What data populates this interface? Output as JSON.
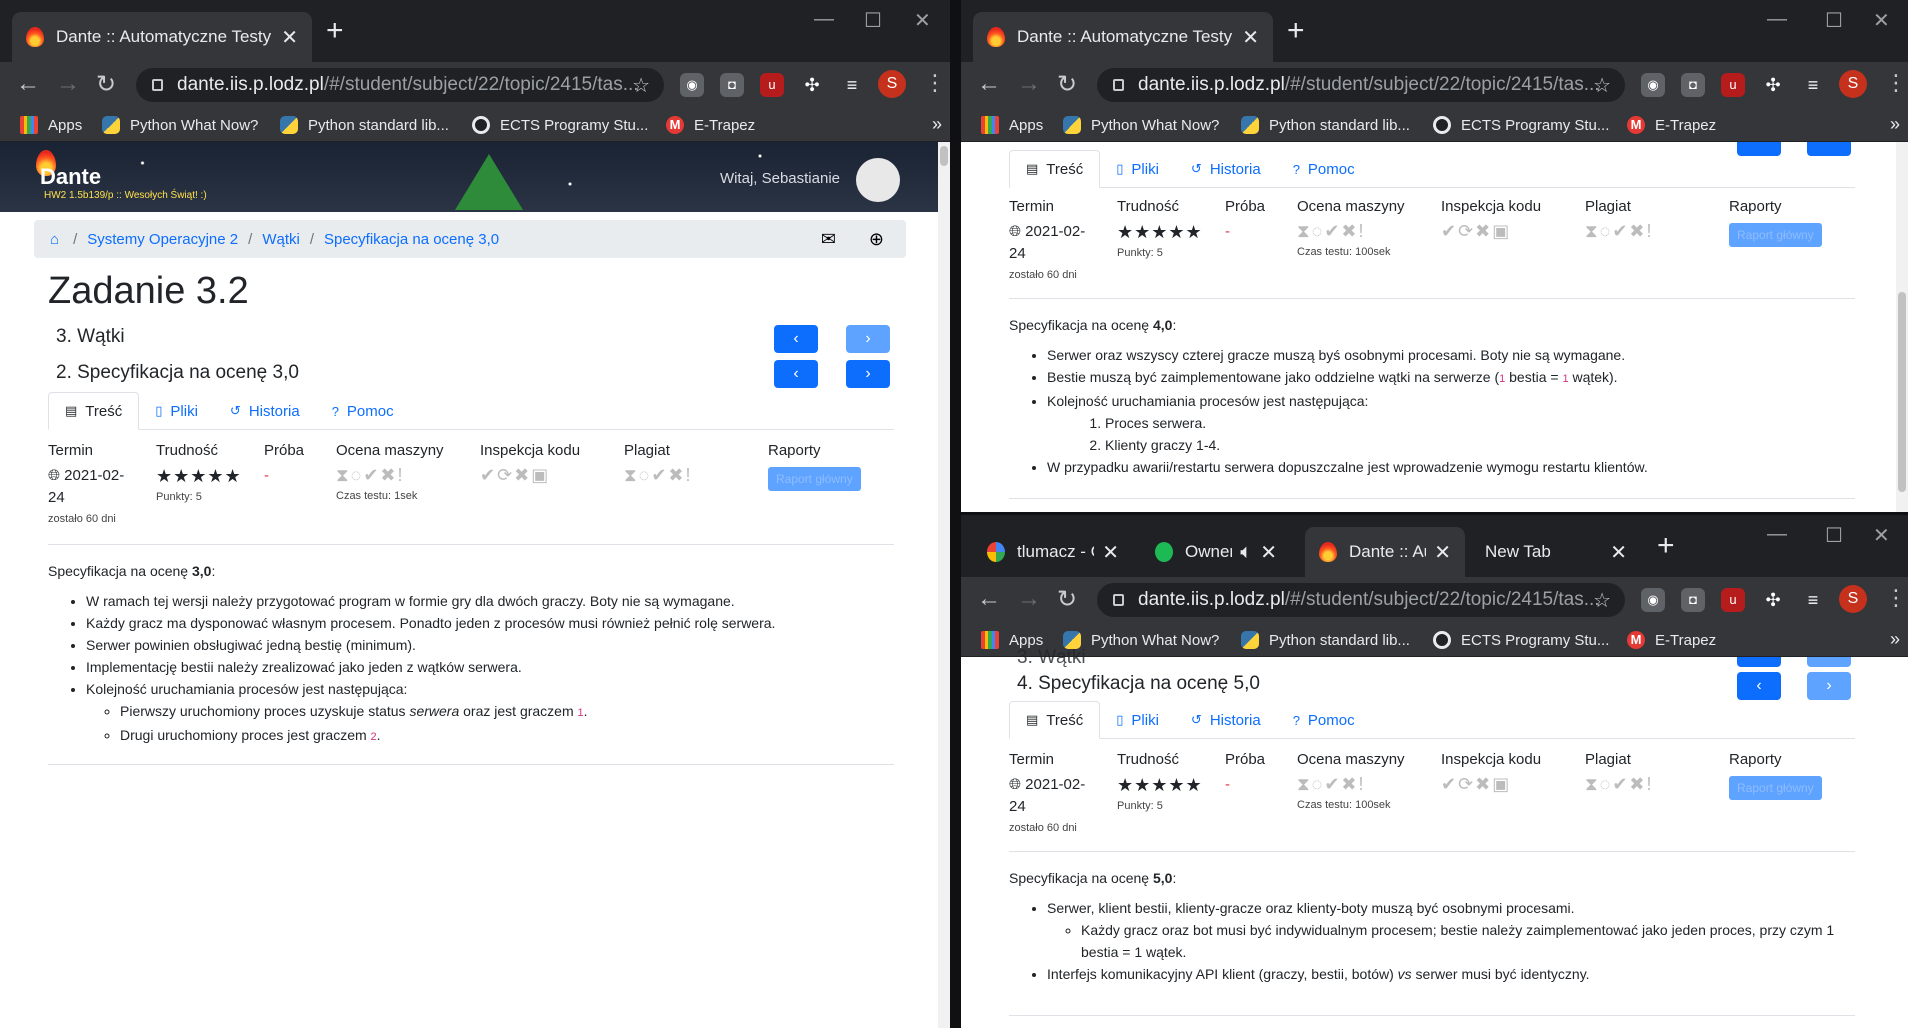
{
  "colors": {
    "accent": "#0d6efd",
    "chrome_dark": "#202124",
    "chrome_tab": "#35363a"
  },
  "tab_title": "Dante :: Automatyczne Testy Jedn",
  "url_host": "dante.iis.p.lodz.pl",
  "url_path": "/#/student/subject/22/topic/2415/tas...",
  "profile_initial": "S",
  "bookmarks": [
    "Apps",
    "Python What Now?",
    "Python standard lib...",
    "ECTS Programy Stu...",
    "E-Trapez"
  ],
  "win3_tabs": [
    "tlumacz - Go",
    "Owner o",
    "Dante :: Auto",
    "New Tab"
  ],
  "banner": {
    "logo": "Dante",
    "sub": "HW2 1.5b139/p :: Wesołych Świąt! :)",
    "welcome": "Witaj, Sebastianie"
  },
  "breadcrumb": [
    "Systemy Operacyjne 2",
    "Wątki",
    "Specyfikacja na ocenę 3,0"
  ],
  "task": {
    "title": "Zadanie 3.2",
    "topic": "3. Wątki",
    "spec3_heading": "2. Specyfikacja na ocenę 3,0",
    "spec5_heading": "4. Specyfikacja na ocenę 5,0",
    "spec5_topic_partial": "3. Wątki"
  },
  "content_tabs": [
    "Treść",
    "Pliki",
    "Historia",
    "Pomoc"
  ],
  "info": {
    "termin_label": "Termin",
    "termin_value": "2021-02-24",
    "termin_left": "zostało 60 dni",
    "trudnosc_label": "Trudność",
    "punkty": "Punkty: 5",
    "proba_label": "Próba",
    "proba_value": "-",
    "ocena_label": "Ocena maszyny",
    "czas1": "Czas testu: 1sek",
    "czas100": "Czas testu: 100sek",
    "inspekcja_label": "Inspekcja kodu",
    "plagiat_label": "Plagiat",
    "raporty_label": "Raporty",
    "raport_btn": "Raport główny",
    "stars": "★★★★★"
  },
  "spec3": {
    "intro": "Specyfikacja na ocenę ",
    "grade": "3,0",
    "items": [
      "W ramach tej wersji należy przygotować program w formie gry dla dwóch graczy. Boty nie są wymagane.",
      "Każdy gracz ma dysponować własnym procesem. Ponadto jeden z procesów musi również pełnić rolę serwera.",
      "Serwer powinien obsługiwać jedną bestię (minimum).",
      "Implementację bestii należy zrealizować jako jeden z wątków serwera.",
      "Kolejność uruchamiania procesów jest następująca:"
    ],
    "sub1a": "Pierwszy uruchomiony proces uzyskuje status ",
    "sub1em": "serwera",
    "sub1b": " oraz jest graczem ",
    "sub1n": "1",
    "sub2a": "Drugi uruchomiony proces jest graczem ",
    "sub2n": "2"
  },
  "spec4": {
    "intro": "Specyfikacja na ocenę ",
    "grade": "4,0",
    "i1": "Serwer oraz wszyscy czterej gracze muszą byś osobnymi procesami. Boty nie są wymagane.",
    "i2a": "Bestie muszą być zaimplementowane jako oddzielne wątki na serwerze (",
    "i2n1": "1",
    "i2b": " bestia = ",
    "i2n2": "1",
    "i2c": " wątek).",
    "i3": "Kolejność uruchamiania procesów jest następująca:",
    "o1": "Proces serwera.",
    "o2": "Klienty graczy 1-4.",
    "i4": "W przypadku awarii/restartu serwera dopuszczalne jest wprowadzenie wymogu restartu klientów."
  },
  "spec5": {
    "intro": "Specyfikacja na ocenę ",
    "grade": "5,0",
    "i1": "Serwer, klient bestii, klienty-gracze oraz klienty-boty muszą być osobnymi procesami.",
    "s1": "Każdy gracz oraz bot musi być indywidualnym procesem; bestie należy zaimplementować jako jeden proces, przy czym 1 bestia = 1 wątek.",
    "i2a": "Interfejs komunikacyjny API klient (graczy, bestii, botów) ",
    "i2em": "vs",
    "i2b": " serwer musi być identyczny."
  }
}
